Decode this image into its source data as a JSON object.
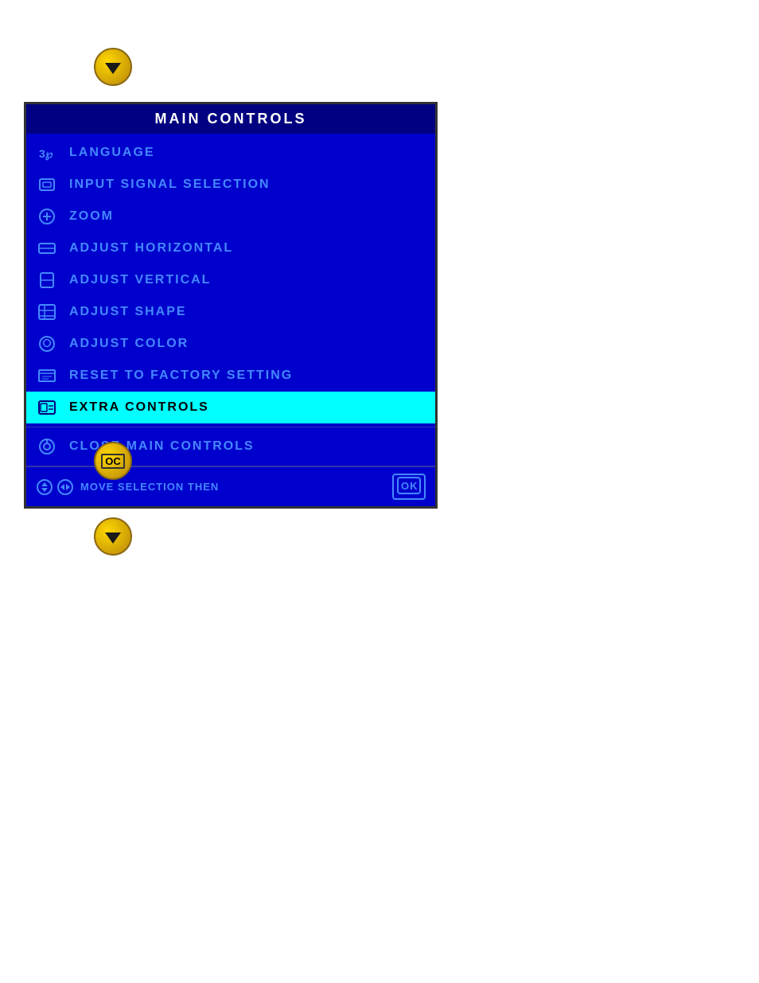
{
  "panel": {
    "title": "MAIN CONTROLS",
    "menu_items": [
      {
        "id": "language",
        "label": "LANGUAGE",
        "icon_unicode": "3℘",
        "active": false
      },
      {
        "id": "input_signal",
        "label": "INPUT SIGNAL SELECTION",
        "icon_unicode": "⊟",
        "active": false
      },
      {
        "id": "zoom",
        "label": "ZOOM",
        "icon_unicode": "⊕",
        "active": false
      },
      {
        "id": "adjust_horizontal",
        "label": "ADJUST HORIZONTAL",
        "icon_unicode": "⊟",
        "active": false
      },
      {
        "id": "adjust_vertical",
        "label": "ADJUST VERTICAL",
        "icon_unicode": "⊡",
        "active": false
      },
      {
        "id": "adjust_shape",
        "label": "ADJUST SHAPE",
        "icon_unicode": "⊞",
        "active": false
      },
      {
        "id": "adjust_color",
        "label": "ADJUST COLOR",
        "icon_unicode": "♺",
        "active": false
      },
      {
        "id": "reset_factory",
        "label": "RESET TO FACTORY SETTING",
        "icon_unicode": "≡",
        "active": false
      },
      {
        "id": "extra_controls",
        "label": "EXTRA CONTROLS",
        "icon_unicode": "▤",
        "active": true
      }
    ],
    "close_item": {
      "id": "close",
      "label": "CLOSE MAIN CONTROLS",
      "icon_unicode": "◎"
    },
    "bottom_bar": {
      "nav_label": "MOVE SELECTION THEN",
      "ok_label": "OK"
    }
  },
  "icons": {
    "top_arrow": "down-arrow",
    "middle_oc": "oc-badge",
    "bottom_arrow": "down-arrow"
  }
}
